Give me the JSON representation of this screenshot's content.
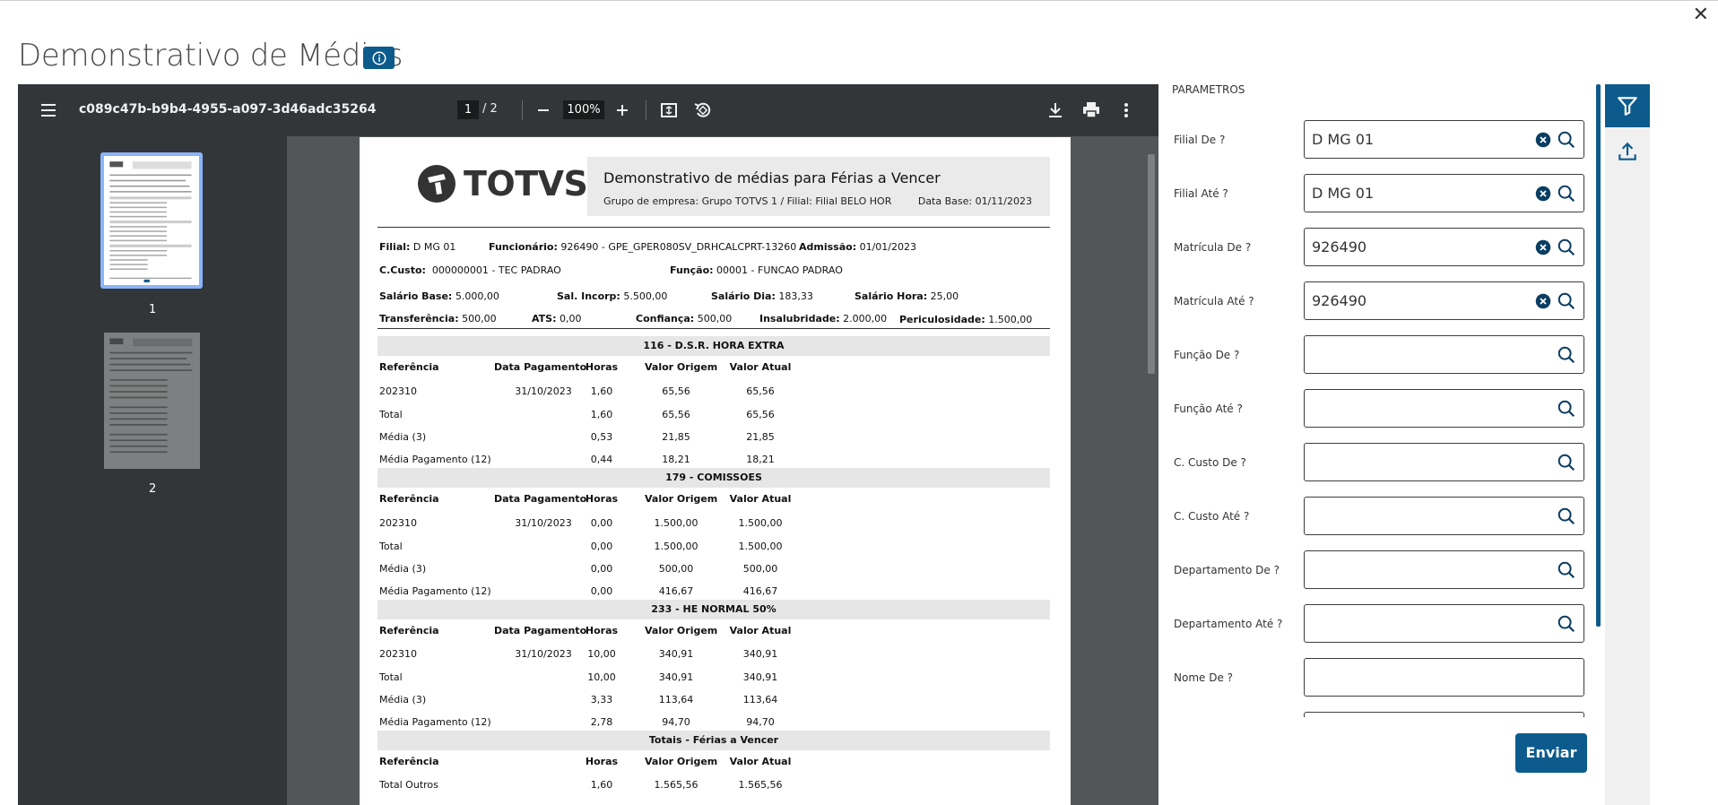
{
  "title": "Demonstrativo de Médias",
  "viewer": {
    "file_name": "c089c47b-b9b4-4955-a097-3d46adc35264",
    "current_page": "1",
    "page_sep": "/ 2",
    "zoom": "100%",
    "thumbs": [
      {
        "label": "1"
      },
      {
        "label": "2"
      }
    ]
  },
  "report": {
    "logo": "TOTVS",
    "title": "Demonstrativo de médias para Férias a Vencer",
    "subtitle": "Grupo de empresa: Grupo TOTVS 1 / Filial: Filial BELO HOR",
    "date": "Data Base: 01/11/2023",
    "info": {
      "filial_l": "Filial:",
      "filial_v": "D MG 01",
      "func_l": "Funcionário:",
      "func_v": "926490 - GPE_GPER080SV_DRHCALCPRT-13260",
      "adm_l": "Admissão:",
      "adm_v": "01/01/2023",
      "ccusto_l": "C.Custo:",
      "ccusto_v": "000000001 - TEC PADRAO",
      "funcao_l": "Função:",
      "funcao_v": "00001 - FUNCAO PADRAO",
      "salbase_l": "Salário Base:",
      "salbase_v": "5.000,00",
      "salincorp_l": "Sal. Incorp:",
      "salincorp_v": "5.500,00",
      "saldia_l": "Salário Dia:",
      "saldia_v": "183,33",
      "salhora_l": "Salário Hora:",
      "salhora_v": "25,00",
      "transf_l": "Transferência:",
      "transf_v": "500,00",
      "ats_l": "ATS:",
      "ats_v": "0,00",
      "conf_l": "Confiança:",
      "conf_v": "500,00",
      "insal_l": "Insalubridade:",
      "insal_v": "2.000,00",
      "peric_l": "Periculosidade:",
      "peric_v": "1.500,00"
    },
    "headers": {
      "ref": "Referência",
      "data": "Data Pagamento",
      "horas": "Horas",
      "orig": "Valor Origem",
      "atual": "Valor Atual"
    },
    "sections": [
      {
        "title": "116 - D.S.R. HORA EXTRA",
        "rows": [
          {
            "ref": "202310",
            "data": "31/10/2023",
            "horas": "1,60",
            "orig": "65,56",
            "atual": "65,56"
          },
          {
            "ref": "Total",
            "data": "",
            "horas": "1,60",
            "orig": "65,56",
            "atual": "65,56"
          },
          {
            "ref": "Média (3)",
            "data": "",
            "horas": "0,53",
            "orig": "21,85",
            "atual": "21,85"
          },
          {
            "ref": "Média Pagamento (12)",
            "data": "",
            "horas": "0,44",
            "orig": "18,21",
            "atual": "18,21"
          }
        ]
      },
      {
        "title": "179 - COMISSOES",
        "rows": [
          {
            "ref": "202310",
            "data": "31/10/2023",
            "horas": "0,00",
            "orig": "1.500,00",
            "atual": "1.500,00"
          },
          {
            "ref": "Total",
            "data": "",
            "horas": "0,00",
            "orig": "1.500,00",
            "atual": "1.500,00"
          },
          {
            "ref": "Média (3)",
            "data": "",
            "horas": "0,00",
            "orig": "500,00",
            "atual": "500,00"
          },
          {
            "ref": "Média Pagamento (12)",
            "data": "",
            "horas": "0,00",
            "orig": "416,67",
            "atual": "416,67"
          }
        ]
      },
      {
        "title": "233 - HE NORMAL 50%",
        "rows": [
          {
            "ref": "202310",
            "data": "31/10/2023",
            "horas": "10,00",
            "orig": "340,91",
            "atual": "340,91"
          },
          {
            "ref": "Total",
            "data": "",
            "horas": "10,00",
            "orig": "340,91",
            "atual": "340,91"
          },
          {
            "ref": "Média (3)",
            "data": "",
            "horas": "3,33",
            "orig": "113,64",
            "atual": "113,64"
          },
          {
            "ref": "Média Pagamento (12)",
            "data": "",
            "horas": "2,78",
            "orig": "94,70",
            "atual": "94,70"
          }
        ]
      }
    ],
    "totals": {
      "title": "Totais - Férias a Vencer",
      "rows": [
        {
          "ref": "Total Outros",
          "horas": "1,60",
          "orig": "1.565,56",
          "atual": "1.565,56"
        }
      ]
    }
  },
  "params": {
    "title": "PARAMETROS",
    "fields": [
      {
        "label": "Filial De ?",
        "value": "D MG 01",
        "clear": true
      },
      {
        "label": "Filial Até ?",
        "value": "D MG 01",
        "clear": true
      },
      {
        "label": "Matrícula De ?",
        "value": "926490",
        "clear": true
      },
      {
        "label": "Matrícula Até ?",
        "value": "926490",
        "clear": true
      },
      {
        "label": "Função De ?",
        "value": "",
        "clear": false
      },
      {
        "label": "Função Até ?",
        "value": "",
        "clear": false
      },
      {
        "label": "C. Custo De ?",
        "value": "",
        "clear": false
      },
      {
        "label": "C. Custo Até ?",
        "value": "",
        "clear": false
      },
      {
        "label": "Departamento De ?",
        "value": "",
        "clear": false
      },
      {
        "label": "Departamento Até ?",
        "value": "",
        "clear": false
      },
      {
        "label": "Nome De ?",
        "value": "",
        "clear": false,
        "nosearch": true
      }
    ],
    "send_label": "Enviar"
  },
  "colors": {
    "primary": "#0c5b8c",
    "viewer_bg": "#525659",
    "toolbar_bg": "#323639"
  }
}
